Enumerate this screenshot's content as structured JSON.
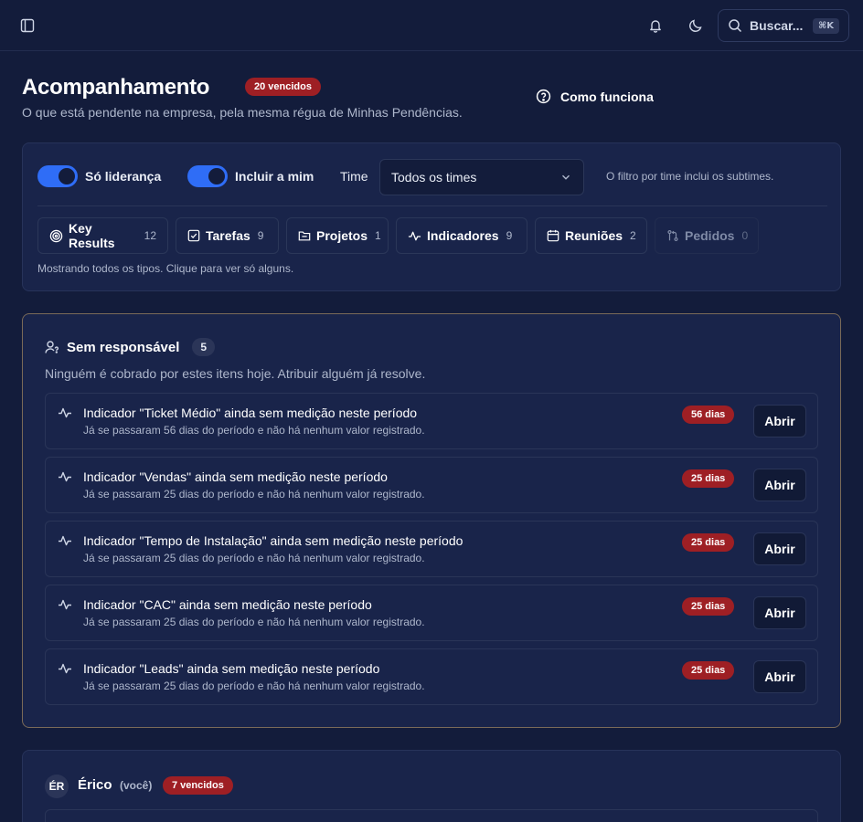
{
  "topbar": {
    "sidebar_toggle_icon": "sidebar-panel-icon",
    "notifications_icon": "bell-icon",
    "theme_icon": "moon-icon",
    "search": {
      "label": "Buscar...",
      "shortcut": "⌘K"
    }
  },
  "header": {
    "title": "Acompanhamento",
    "overdue_badge": "20 vencidos",
    "subtitle": "O que está pendente na empresa, pela mesma régua de Minhas Pendências.",
    "how_it_works": "Como funciona"
  },
  "filters": {
    "only_leadership": {
      "label": "Só liderança",
      "enabled": true
    },
    "include_me": {
      "label": "Incluir a mim",
      "enabled": true
    },
    "team_label": "Time",
    "team_select": "Todos os times",
    "team_hint": "O filtro por time inclui os subtimes.",
    "types": [
      {
        "label": "Key Results",
        "count": "12",
        "icon": "target-icon"
      },
      {
        "label": "Tarefas",
        "count": "9",
        "icon": "checkbox-icon"
      },
      {
        "label": "Projetos",
        "count": "1",
        "icon": "folder-icon"
      },
      {
        "label": "Indicadores",
        "count": "9",
        "icon": "activity-icon"
      },
      {
        "label": "Reuniões",
        "count": "2",
        "icon": "calendar-icon"
      },
      {
        "label": "Pedidos",
        "count": "0",
        "icon": "git-pull-icon"
      }
    ],
    "note": "Mostrando todos os tipos. Clique para ver só alguns."
  },
  "unassigned": {
    "title": "Sem responsável",
    "count": "5",
    "description": "Ninguém é cobrado por estes itens hoje. Atribuir alguém já resolve.",
    "open_label": "Abrir",
    "items": [
      {
        "title": "Indicador \"Ticket Médio\" ainda sem medição neste período",
        "description": "Já se passaram 56 dias do período e não há nenhum valor registrado.",
        "badge": "56 dias"
      },
      {
        "title": "Indicador \"Vendas\" ainda sem medição neste período",
        "description": "Já se passaram 25 dias do período e não há nenhum valor registrado.",
        "badge": "25 dias"
      },
      {
        "title": "Indicador \"Tempo de Instalação\" ainda sem medição neste período",
        "description": "Já se passaram 25 dias do período e não há nenhum valor registrado.",
        "badge": "25 dias"
      },
      {
        "title": "Indicador \"CAC\" ainda sem medição neste período",
        "description": "Já se passaram 25 dias do período e não há nenhum valor registrado.",
        "badge": "25 dias"
      },
      {
        "title": "Indicador \"Leads\" ainda sem medição neste período",
        "description": "Já se passaram 25 dias do período e não há nenhum valor registrado.",
        "badge": "25 dias"
      }
    ]
  },
  "person": {
    "initials": "ÉR",
    "name": "Érico",
    "you": "(você)",
    "badge": "7 vencidos"
  }
}
